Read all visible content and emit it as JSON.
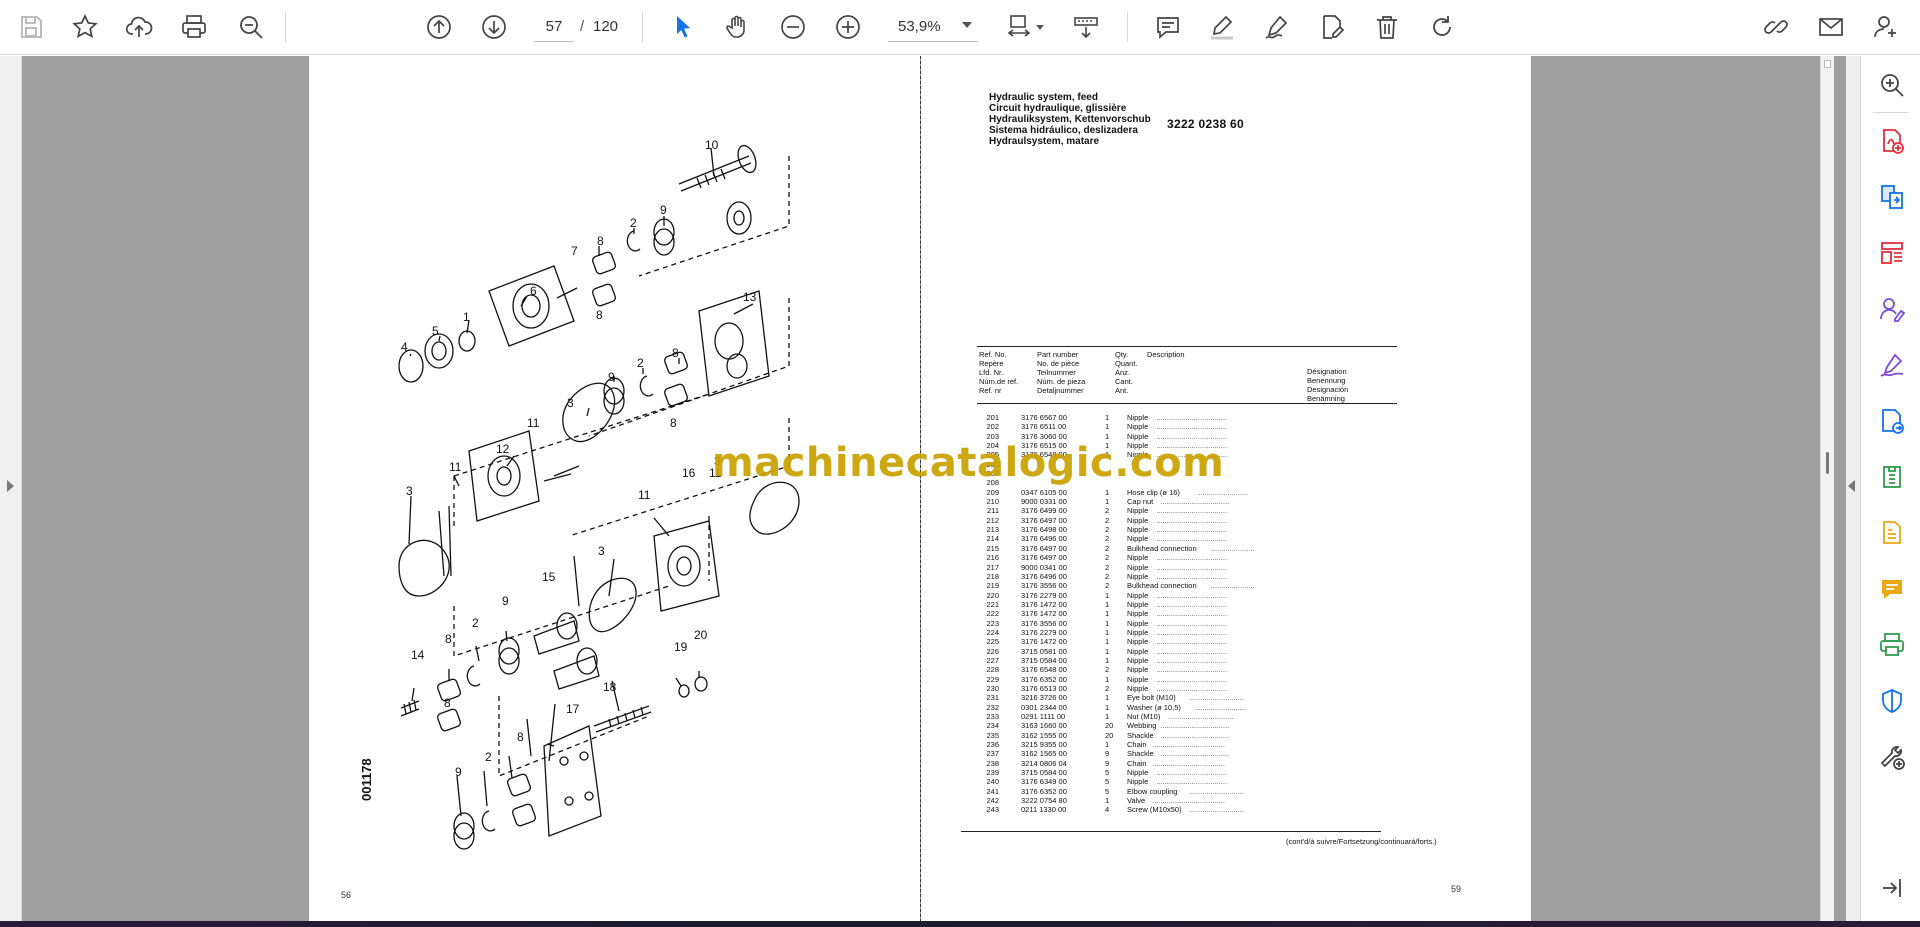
{
  "toolbar": {
    "page_current": "57",
    "page_separator": "/",
    "page_total": "120",
    "zoom": "53,9%",
    "icons": [
      "save-icon",
      "bookmark-star-icon",
      "cloud-upload-icon",
      "print-icon",
      "zoom-search-icon",
      "page-up-icon",
      "page-down-icon",
      "select-arrow-icon",
      "hand-tool-icon",
      "zoom-out-icon",
      "zoom-in-icon",
      "fit-page-icon",
      "scroll-mode-icon",
      "comment-icon",
      "highlight-icon",
      "draw-icon",
      "edit-text-icon",
      "delete-icon",
      "rotate-icon",
      "share-link-icon",
      "email-icon",
      "add-user-icon"
    ]
  },
  "watermark": "machinecatalogic.com",
  "left_page": {
    "page_number": "56",
    "diagram_code": "001178",
    "callouts": [
      "1",
      "2",
      "3",
      "4",
      "5",
      "6",
      "7",
      "8",
      "9",
      "10",
      "11",
      "12",
      "13",
      "14",
      "15",
      "16",
      "17",
      "18",
      "19",
      "20"
    ]
  },
  "right_page": {
    "page_number": "59",
    "titles": [
      "Hydraulic system, feed",
      "Circuit hydraulique, glissière",
      "Hydrauliksystem, Kettenvorschub",
      "Sistema hidráulico, deslizadera",
      "Hydraulsystem, matare"
    ],
    "doc_number": "3222 0238 60",
    "headers": {
      "ref": [
        "Ref. No.",
        "Repère",
        "Lfd. Nr.",
        "Núm.de ref.",
        "Ref. nr"
      ],
      "part": [
        "Part number",
        "No. de pièce",
        "Teilnummer",
        "Núm. de pieza",
        "Detaljnummer"
      ],
      "qty": [
        "Qty.",
        "Quant.",
        "Anz.",
        "Cant.",
        "Ant."
      ],
      "desc": "Description",
      "desc_lang": [
        "Désignation",
        "Benennung",
        "Designación",
        "Benämning"
      ]
    },
    "rows": [
      {
        "ref": "201",
        "part": "3176 6567 00",
        "qty": "1",
        "desc": "Nipple"
      },
      {
        "ref": "202",
        "part": "3176 6511 00",
        "qty": "1",
        "desc": "Nipple"
      },
      {
        "ref": "203",
        "part": "3176 3060 00",
        "qty": "1",
        "desc": "Nipple"
      },
      {
        "ref": "204",
        "part": "3176 6515 00",
        "qty": "1",
        "desc": "Nipple"
      },
      {
        "ref": "205",
        "part": "3176 6548 00",
        "qty": "1",
        "desc": "Nipple"
      },
      {
        "ref": "206",
        "part": "",
        "qty": "",
        "desc": ""
      },
      {
        "ref": "207",
        "part": "",
        "qty": "",
        "desc": ""
      },
      {
        "ref": "208",
        "part": "",
        "qty": "",
        "desc": ""
      },
      {
        "ref": "209",
        "part": "0347 6105 00",
        "qty": "1",
        "desc": "Hose clip (ø 16)"
      },
      {
        "ref": "210",
        "part": "9000 0331 00",
        "qty": "1",
        "desc": "Cap nut"
      },
      {
        "ref": "211",
        "part": "3176 6499 00",
        "qty": "2",
        "desc": "Nipple"
      },
      {
        "ref": "212",
        "part": "3176 6497 00",
        "qty": "2",
        "desc": "Nipple"
      },
      {
        "ref": "213",
        "part": "3176 6498 00",
        "qty": "2",
        "desc": "Nipple"
      },
      {
        "ref": "214",
        "part": "3176 6496 00",
        "qty": "2",
        "desc": "Nipple"
      },
      {
        "ref": "215",
        "part": "3176 6497 00",
        "qty": "2",
        "desc": "Bulkhead connection"
      },
      {
        "ref": "216",
        "part": "3176 6497 00",
        "qty": "2",
        "desc": "Nipple"
      },
      {
        "ref": "217",
        "part": "9000 0341 00",
        "qty": "2",
        "desc": "Nipple"
      },
      {
        "ref": "218",
        "part": "3176 6496 00",
        "qty": "2",
        "desc": "Nipple"
      },
      {
        "ref": "219",
        "part": "3176 3556 00",
        "qty": "2",
        "desc": "Bulkhead connection"
      },
      {
        "ref": "220",
        "part": "3176 2279 00",
        "qty": "1",
        "desc": "Nipple"
      },
      {
        "ref": "221",
        "part": "3176 1472 00",
        "qty": "1",
        "desc": "Nipple"
      },
      {
        "ref": "222",
        "part": "3176 1472 00",
        "qty": "1",
        "desc": "Nipple"
      },
      {
        "ref": "223",
        "part": "3176 3556 00",
        "qty": "1",
        "desc": "Nipple"
      },
      {
        "ref": "224",
        "part": "3176 2279 00",
        "qty": "1",
        "desc": "Nipple"
      },
      {
        "ref": "225",
        "part": "3176 1472 00",
        "qty": "1",
        "desc": "Nipple"
      },
      {
        "ref": "226",
        "part": "3715 0581 00",
        "qty": "1",
        "desc": "Nipple"
      },
      {
        "ref": "227",
        "part": "3715 0584 00",
        "qty": "1",
        "desc": "Nipple"
      },
      {
        "ref": "228",
        "part": "3176 6548 00",
        "qty": "2",
        "desc": "Nipple"
      },
      {
        "ref": "229",
        "part": "3176 6352 00",
        "qty": "1",
        "desc": "Nipple"
      },
      {
        "ref": "230",
        "part": "3176 6513 00",
        "qty": "2",
        "desc": "Nipple"
      },
      {
        "ref": "231",
        "part": "3216 3726 00",
        "qty": "1",
        "desc": "Eye bolt (M10)"
      },
      {
        "ref": "232",
        "part": "0301 2344 00",
        "qty": "1",
        "desc": "Washer (ø 10,5)"
      },
      {
        "ref": "233",
        "part": "0291 1111 00",
        "qty": "1",
        "desc": "Nut (M10)"
      },
      {
        "ref": "234",
        "part": "3163 1660 00",
        "qty": "20",
        "desc": "Webbing"
      },
      {
        "ref": "235",
        "part": "3162 1555 00",
        "qty": "20",
        "desc": "Shackle"
      },
      {
        "ref": "236",
        "part": "3215 9355 00",
        "qty": "1",
        "desc": "Chain"
      },
      {
        "ref": "237",
        "part": "3162 1565 00",
        "qty": "9",
        "desc": "Shackle"
      },
      {
        "ref": "238",
        "part": "3214 0806 04",
        "qty": "9",
        "desc": "Chain"
      },
      {
        "ref": "239",
        "part": "3715 0584 00",
        "qty": "5",
        "desc": "Nipple"
      },
      {
        "ref": "240",
        "part": "3176 6349 00",
        "qty": "5",
        "desc": "Nipple"
      },
      {
        "ref": "241",
        "part": "3176 6352 00",
        "qty": "5",
        "desc": "Elbow coupling"
      },
      {
        "ref": "242",
        "part": "3222 0754 80",
        "qty": "1",
        "desc": "Valve"
      },
      {
        "ref": "243",
        "part": "0211 1330 00",
        "qty": "4",
        "desc": "Screw (M10x50)"
      }
    ],
    "continued": "(cont'd/à suivre/Fortsetzung/continuará/forts.)"
  },
  "sidebar": {
    "icons": [
      "zoom-page-icon",
      "create-pdf-icon",
      "export-pdf-icon",
      "organize-pages-icon",
      "request-signature-icon",
      "fill-sign-icon",
      "send-track-icon",
      "compress-pdf-icon",
      "edit-pdf-icon",
      "comment-panel-icon",
      "print-production-icon",
      "protect-icon",
      "more-tools-icon",
      "collapse-panel-icon"
    ]
  },
  "colors": {
    "accent_blue": "#1473e6",
    "sidebar_red": "#e0303a",
    "sidebar_purple": "#7b4bd6",
    "sidebar_green": "#2d9d4a",
    "sidebar_yellow": "#e8a812",
    "watermark": "#c9a100"
  }
}
